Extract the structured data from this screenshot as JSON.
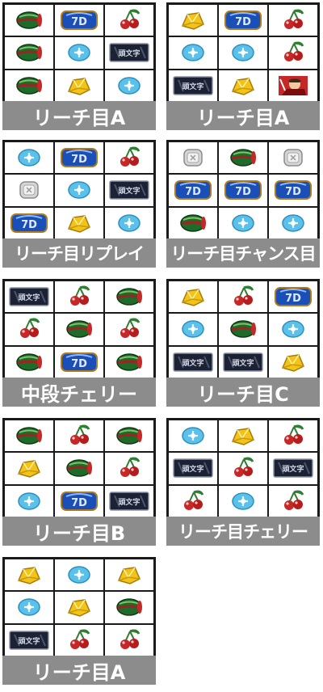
{
  "symbols": {
    "W": "watermelon-icon",
    "D": "blue-7d-icon",
    "C": "cherry-icon",
    "B": "bell-icon",
    "R": "replay-icon",
    "K": "dark-bar-icon",
    "P": "character-icon",
    "S": "silver-icon"
  },
  "colors": {
    "label_bg": "#8c8c8c",
    "border": "#1a1a1a",
    "label_text": "#ffffff"
  },
  "panels": [
    {
      "label": "リーチ目A",
      "cells": [
        [
          "W",
          "D",
          "C"
        ],
        [
          "W",
          "R",
          "K"
        ],
        [
          "W",
          "B",
          "R"
        ]
      ]
    },
    {
      "label": "リーチ目A",
      "cells": [
        [
          "B",
          "D",
          "C"
        ],
        [
          "R",
          "R",
          "C"
        ],
        [
          "K",
          "B",
          "P"
        ]
      ]
    },
    {
      "label": "リーチ目リプレイ",
      "cells": [
        [
          "R",
          "D",
          "C"
        ],
        [
          "S",
          "R",
          "K"
        ],
        [
          "D",
          "B",
          "R"
        ]
      ]
    },
    {
      "label": "リーチ目チャンス目",
      "cells": [
        [
          "S",
          "W",
          "S"
        ],
        [
          "D",
          "D",
          "D"
        ],
        [
          "W",
          "R",
          "R"
        ]
      ]
    },
    {
      "label": "中段チェリー",
      "cells": [
        [
          "K",
          "C",
          "W"
        ],
        [
          "C",
          "W",
          "C"
        ],
        [
          "W",
          "D",
          "W"
        ]
      ]
    },
    {
      "label": "リーチ目C",
      "cells": [
        [
          "B",
          "C",
          "D"
        ],
        [
          "R",
          "W",
          "R"
        ],
        [
          "K",
          "K",
          "B"
        ]
      ]
    },
    {
      "label": "リーチ目B",
      "cells": [
        [
          "W",
          "C",
          "W"
        ],
        [
          "B",
          "W",
          "C"
        ],
        [
          "R",
          "D",
          "K"
        ]
      ]
    },
    {
      "label": "リーチ目チェリー",
      "cells": [
        [
          "R",
          "B",
          "C"
        ],
        [
          "K",
          "C",
          "K"
        ],
        [
          "C",
          "R",
          "C"
        ]
      ]
    },
    {
      "label": "リーチ目A",
      "cells": [
        [
          "B",
          "R",
          "B"
        ],
        [
          "R",
          "B",
          "W"
        ],
        [
          "K",
          "C",
          "C"
        ]
      ]
    }
  ]
}
